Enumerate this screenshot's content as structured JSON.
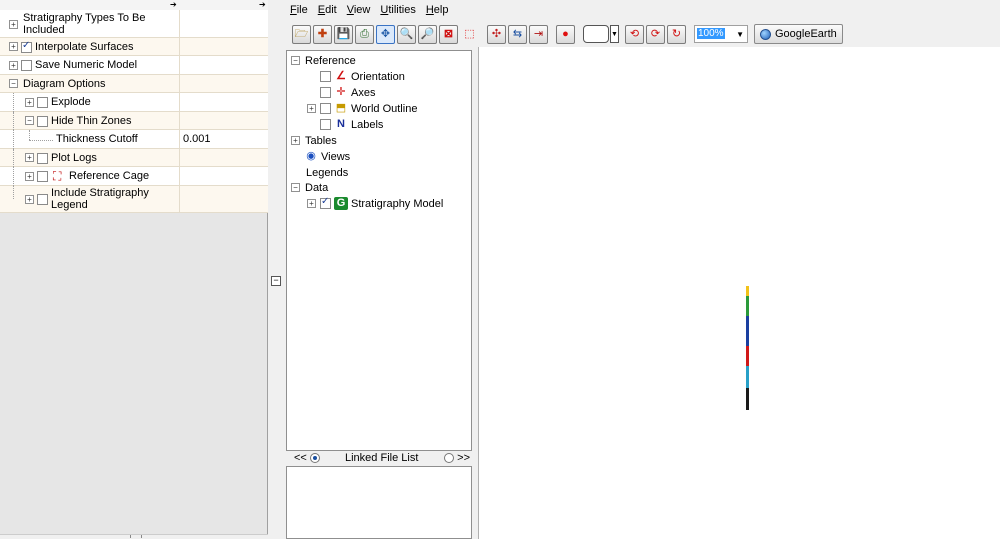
{
  "window": {
    "menu": [
      {
        "key": "F",
        "rest": "ile"
      },
      {
        "key": "E",
        "rest": "dit"
      },
      {
        "key": "V",
        "rest": "iew"
      },
      {
        "key": "U",
        "rest": "tilities"
      },
      {
        "key": "H",
        "rest": "elp"
      }
    ]
  },
  "properties": {
    "rows": [
      {
        "line1": "Stratigraphy Types To Be",
        "line2": "Included",
        "value": ""
      },
      {
        "label": "Interpolate Surfaces",
        "checked": true,
        "value": ""
      },
      {
        "label": "Save Numeric Model",
        "checked": false,
        "value": ""
      },
      {
        "label": "Diagram Options",
        "value": ""
      },
      {
        "label": "Explode",
        "checked": false,
        "value": ""
      },
      {
        "label": "Hide Thin Zones",
        "checked": false,
        "value": ""
      },
      {
        "label": "Thickness Cutoff",
        "value": "0.001"
      },
      {
        "label": "Plot Logs",
        "checked": false,
        "value": ""
      },
      {
        "label": "Reference Cage",
        "checked": false,
        "value": ""
      },
      {
        "line1": "Include Stratigraphy",
        "line2": "Legend",
        "checked": false,
        "value": ""
      }
    ]
  },
  "toolbar": {
    "zoom_value": "100%",
    "google_earth_label": "GoogleEarth"
  },
  "tree": {
    "reference": "Reference",
    "orientation": "Orientation",
    "axes": "Axes",
    "world_outline": "World Outline",
    "labels": "Labels",
    "tables": "Tables",
    "views": "Views",
    "legends": "Legends",
    "data": "Data",
    "stratigraphy_model": "Stratigraphy Model"
  },
  "linked_files": {
    "prev": "<<",
    "title": "Linked File List",
    "next": ">>"
  },
  "icons": {
    "expand": "plus-box-icon",
    "collapse": "minus-box-icon",
    "checkbox": "checkbox-icon"
  },
  "colors": {
    "selection": "#3399ff",
    "alt_row": "#fdf8ef",
    "model_green": "#1a8a2e"
  }
}
